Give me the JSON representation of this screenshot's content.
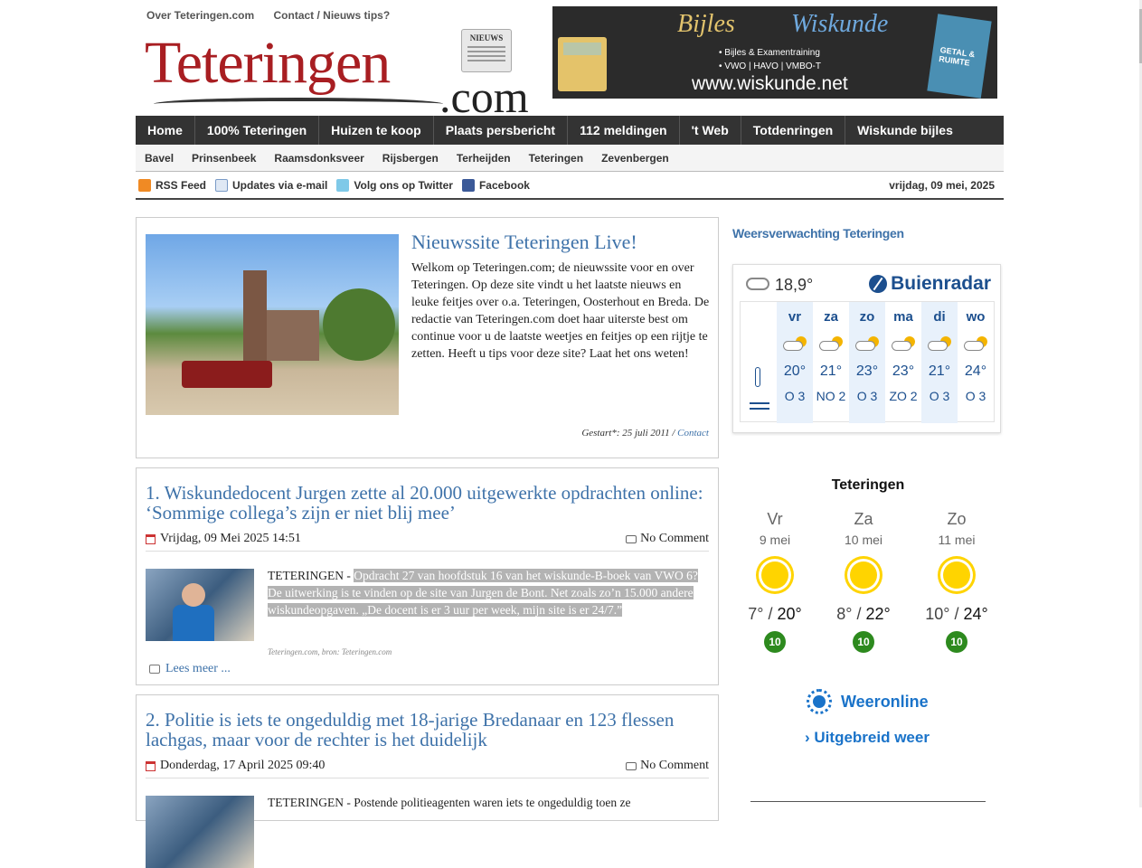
{
  "top_links": [
    "Over Teteringen.com",
    "Contact / Nieuws tips?"
  ],
  "logo": {
    "main": "Teteringen",
    "suffix": ".com",
    "news_badge": "NIEUWS"
  },
  "banner": {
    "title_left": "Bijles",
    "title_right": "Wiskunde",
    "bullets": [
      "• Bijles & Examentraining",
      "• VWO | HAVO | VMBO-T"
    ],
    "url": "www.wiskunde.net",
    "book_text": "GETAL & RUIMTE"
  },
  "main_nav": [
    "Home",
    "100% Teteringen",
    "Huizen te koop",
    "Plaats persbericht",
    "112 meldingen",
    "'t Web",
    "Totdenringen",
    "Wiskunde bijles"
  ],
  "sub_nav": [
    "Bavel",
    "Prinsenbeek",
    "Raamsdonksveer",
    "Rijsbergen",
    "Terheijden",
    "Teteringen",
    "Zevenbergen"
  ],
  "social": [
    {
      "icon": "rss-icon",
      "label": "RSS Feed"
    },
    {
      "icon": "mail-icon",
      "label": "Updates via e-mail"
    },
    {
      "icon": "twitter-icon",
      "label": "Volg ons op Twitter"
    },
    {
      "icon": "facebook-icon",
      "label": "Facebook"
    }
  ],
  "date": "vrijdag, 09 mei, 2025",
  "welcome": {
    "title": "Nieuwssite Teteringen Live!",
    "text": "Welkom op Teteringen.com; de nieuwssite voor en over Teteringen. Op deze site vindt u het laatste nieuws en leuke feitjes over o.a. Teteringen, Oosterhout en Breda. De redactie van Teteringen.com doet haar uiterste best om continue voor u de laatste weetjes en feitjes op een rijtje te zetten. Heeft u tips voor deze site? Laat het ons weten!",
    "started_label": "Gestart*: 25 juli 2011 /",
    "contact_link": "Contact"
  },
  "articles": [
    {
      "title": "1. Wiskundedocent Jurgen zette al 20.000 uitgewerkte opdrachten online: ‘Sommige collega’s zijn er niet blij mee’",
      "date": "Vrijdag, 09 Mei 2025 14:51",
      "comments": "No Comment",
      "lead": "TETERINGEN -",
      "excerpt": "Opdracht 27 van hoofdstuk 16 van het wiskunde-B-boek van VWO 6? De uitwerking is te vinden op de site van Jurgen de Bont. Net zoals zo’n 15.000 andere wiskundeopgaven. „De docent is er 3 uur per week, mijn site is er 24/7.”",
      "source": "Teteringen.com, bron: Teteringen.com",
      "read_more": "Lees meer ..."
    },
    {
      "title": "2. Politie is iets te ongeduldig met 18-jarige Bredanaar en 123 flessen lachgas, maar voor de rechter is het duidelijk",
      "date": "Donderdag, 17 April 2025 09:40",
      "comments": "No Comment",
      "lead": "TETERINGEN -",
      "excerpt": "Postende politieagenten waren iets te ongeduldig toen ze"
    }
  ],
  "sidebar": {
    "weather_heading": "Weersverwachting Teteringen",
    "buienradar": {
      "current_temp": "18,9°",
      "brand": "Buienradar",
      "days": [
        {
          "name": "vr",
          "temp": "20°",
          "wind": "O 3"
        },
        {
          "name": "za",
          "temp": "21°",
          "wind": "NO 2"
        },
        {
          "name": "zo",
          "temp": "23°",
          "wind": "O 3"
        },
        {
          "name": "ma",
          "temp": "23°",
          "wind": "ZO 2"
        },
        {
          "name": "di",
          "temp": "21°",
          "wind": "O 3"
        },
        {
          "name": "wo",
          "temp": "24°",
          "wind": "O 3"
        }
      ]
    },
    "weeronline": {
      "city": "Teteringen",
      "days": [
        {
          "name": "Vr",
          "date": "9 mei",
          "min": "7°",
          "max": "20°",
          "uv": "10"
        },
        {
          "name": "Za",
          "date": "10 mei",
          "min": "8°",
          "max": "22°",
          "uv": "10"
        },
        {
          "name": "Zo",
          "date": "11 mei",
          "min": "10°",
          "max": "24°",
          "uv": "10"
        }
      ],
      "brand": "Weeronline",
      "more": "Uitgebreid weer"
    }
  },
  "colors": {
    "brand_red": "#a81e22",
    "nav_dark": "#333333",
    "link_blue": "#3e72a9",
    "buienradar_blue": "#1c4f8e",
    "weeronline_blue": "#1a73c9"
  }
}
